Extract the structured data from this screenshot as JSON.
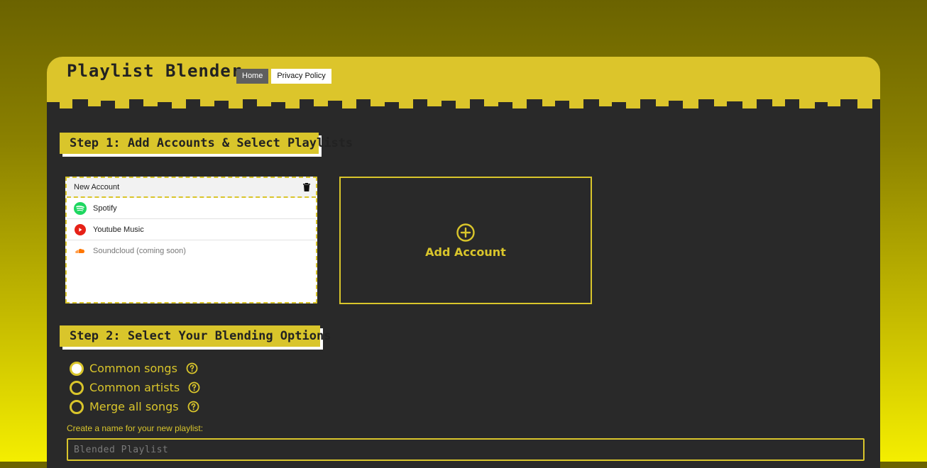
{
  "app": {
    "title": "Playlist Blender"
  },
  "nav": {
    "home_label": "Home",
    "privacy_label": "Privacy Policy"
  },
  "step1": {
    "label": "Step 1: Add Accounts & Select Playlists"
  },
  "account_card": {
    "title": "New Account",
    "services": [
      {
        "label": "Spotify",
        "icon": "spotify-icon",
        "enabled": true
      },
      {
        "label": "Youtube Music",
        "icon": "youtube-music-icon",
        "enabled": true
      },
      {
        "label": "Soundcloud (coming soon)",
        "icon": "soundcloud-icon",
        "enabled": false
      }
    ]
  },
  "add_account": {
    "label": "Add Account",
    "icon": "plus-circle-icon"
  },
  "step2": {
    "label": "Step 2: Select Your Blending Options"
  },
  "options": [
    {
      "label": "Common songs",
      "selected": true
    },
    {
      "label": "Common artists",
      "selected": false
    },
    {
      "label": "Merge all songs",
      "selected": false
    }
  ],
  "playlist_name": {
    "label": "Create a name for your new playlist:",
    "placeholder": "Blended Playlist",
    "value": ""
  },
  "colors": {
    "accent": "#d9c52b",
    "panel": "#292929",
    "spotify": "#1ed760",
    "youtube": "#e62117",
    "soundcloud": "#ff7700"
  }
}
